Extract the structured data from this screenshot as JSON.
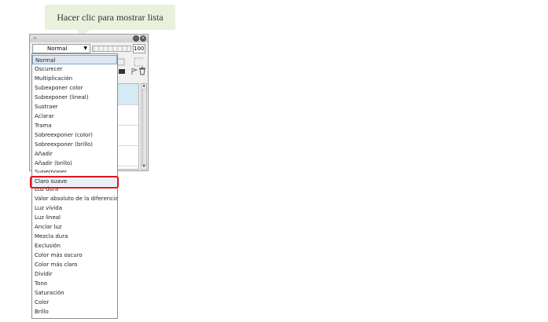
{
  "callout": {
    "text": "Hacer clic para mostrar lista"
  },
  "panel": {
    "blend_mode": "Normal",
    "opacity_value": "100"
  },
  "dropdown": {
    "items": [
      "Normal",
      "Oscurecer",
      "Multiplicación",
      "Subexponer color",
      "Subexponer (lineal)",
      "Sustraer",
      "Aclarar",
      "Trama",
      "Sobreexponer (color)",
      "Sobreexponer (brillo)",
      "Añadir",
      "Añadir (brillo)",
      "Superponer",
      "Claro suave",
      "Luz dura",
      "Valor absoluto de la diferencia",
      "Luz vívida",
      "Luz lineal",
      "Anclar luz",
      "Mezcla dura",
      "Exclusión",
      "Color más oscuro",
      "Color más claro",
      "Dividir",
      "Tono",
      "Saturación",
      "Color",
      "Brillo"
    ],
    "current": "Normal",
    "highlighted": "Claro suave"
  },
  "colors": {
    "highlight_border": "#e0161b",
    "callout_bg": "#e9f0dc"
  }
}
